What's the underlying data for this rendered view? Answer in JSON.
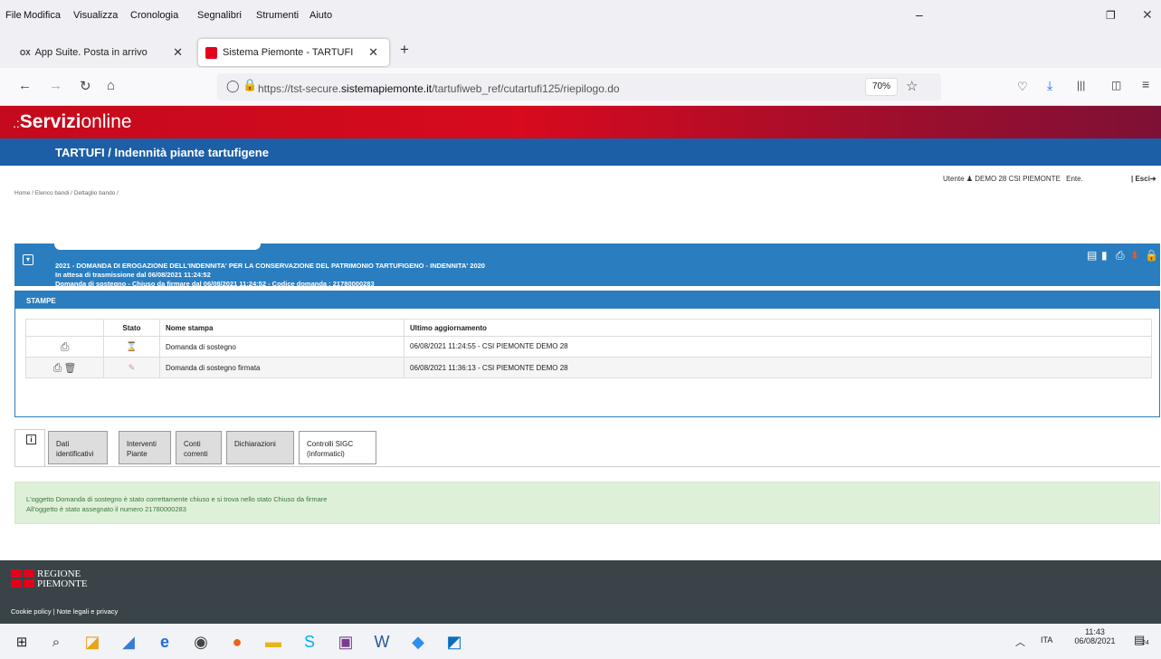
{
  "menu": [
    "File",
    "Modifica",
    "Visualizza",
    "Cronologia",
    "Segnalibri",
    "Strumenti",
    "Aiuto"
  ],
  "tabs": {
    "tab1": "App Suite. Posta in arrivo",
    "tab1_prefix": "OX",
    "tab2": "Sistema Piemonte - TARTUFI"
  },
  "url": {
    "prefix": "https://tst-secure.",
    "domain": "sistemapiemonte.it",
    "path": "/tartufiweb_ref/cutartufi125/riepilogo.do"
  },
  "zoom": "70%",
  "brand": {
    "bold": "Servizi",
    "light": "online",
    "dots": ".:"
  },
  "page_title": "TARTUFI / Indennità piante tartufigene",
  "user": {
    "label": "Utente",
    "name": "DEMO 28 CSI PIEMONTE",
    "ente": "Ente.",
    "exit": "| Esci"
  },
  "breadcrumb": "Home / Elenco bandi / Dettaglio bando /",
  "bando": {
    "line1": "2021 - DOMANDA DI EROGAZIONE DELL'INDENNITA' PER LA CONSERVAZIONE DEL PATRIMONIO TARTUFIGENO - INDENNITA' 2020",
    "line2": "In attesa di trasmissione dal 06/08/2021 11:24:52",
    "line3": "Domanda di sostegno - Chiuso da firmare dal 06/08/2021 11:24:52 - Codice domanda : 21780000283"
  },
  "stampe": {
    "title": "STAMPE",
    "headers": [
      "",
      "Stato",
      "Nome stampa",
      "Ultimo aggiornamento"
    ],
    "rows": [
      {
        "nome": "Domanda di sostegno",
        "agg": "06/08/2021 11:24:55 - CSI PIEMONTE DEMO 28"
      },
      {
        "nome": "Domanda di sostegno firmata",
        "agg": "06/08/2021 11:36:13 - CSI PIEMONTE DEMO 28"
      }
    ]
  },
  "nav_tabs": [
    {
      "l1": "Dati",
      "l2": "identificativi"
    },
    {
      "l1": "Interventi",
      "l2": "Piante"
    },
    {
      "l1": "Conti",
      "l2": "correnti"
    },
    {
      "l1": "Dichiarazioni",
      "l2": ""
    },
    {
      "l1": "Controlli SIGC",
      "l2": "(informatici)"
    }
  ],
  "message": {
    "line1": "L'oggetto Domanda di sostegno è stato correttamente chiuso e si trova nello stato Chiuso da firmare",
    "line2": "All'oggetto è stato assegnato il numero 21780000283"
  },
  "footer": {
    "region1": "REGIONE",
    "region2": "PIEMONTE",
    "links": "Cookie policy  |  Note legali e privacy"
  },
  "taskbar": {
    "lang": "ITA",
    "time": "11:43",
    "date": "06/08/2021",
    "notif": "24"
  },
  "colors": {
    "brand_red": "#c40a1c",
    "title_blue": "#1c5fa7",
    "panel_blue": "#2a7ec0",
    "success_bg": "#dff0d8",
    "footer": "#3a4448"
  }
}
